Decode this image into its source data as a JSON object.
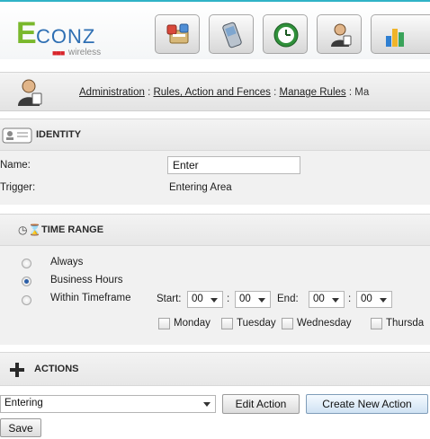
{
  "header": {
    "logo": {
      "mark": "E",
      "brand": "CONZ",
      "dots": "■■■",
      "tagline": "wireless"
    },
    "apps": [
      {
        "name": "settings-app",
        "icon": "tools-icon"
      },
      {
        "name": "device-app",
        "icon": "phone-icon"
      },
      {
        "name": "clock-app",
        "icon": "clock-icon"
      },
      {
        "name": "admin-app",
        "icon": "admin-person-icon"
      },
      {
        "name": "reports-app",
        "icon": "bar-chart-icon"
      }
    ]
  },
  "breadcrumb": {
    "items": [
      "Administration",
      "Rules, Action and Fences",
      "Manage Rules",
      "Ma"
    ],
    "separator": " : "
  },
  "identity": {
    "title": "IDENTITY",
    "name_label": "Name:",
    "name_value": "Enter",
    "trigger_label": "Trigger:",
    "trigger_value": "Entering Area"
  },
  "time_range": {
    "title": "TIME RANGE",
    "options": [
      "Always",
      "Business Hours",
      "Within Timeframe"
    ],
    "selected": "Business Hours",
    "start_label": "Start:",
    "start_hour": "00",
    "start_min": "00",
    "end_label": "End:",
    "end_hour": "00",
    "end_min": "00",
    "colon": ":",
    "days": [
      "Monday",
      "Tuesday",
      "Wednesday",
      "Thursda"
    ]
  },
  "actions": {
    "title": "ACTIONS",
    "selected_action": "Entering",
    "edit_label": "Edit Action",
    "create_label": "Create New Action"
  },
  "footer": {
    "save_label": "Save"
  },
  "colors": {
    "top_accent": "#30b3c6",
    "logo_green": "#7ab82c",
    "logo_blue": "#2e6fb3",
    "logo_red": "#d8242a"
  }
}
